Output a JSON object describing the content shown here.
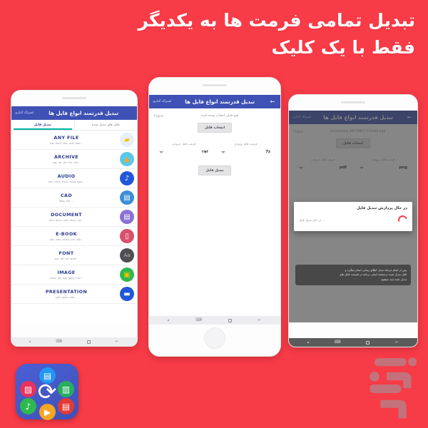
{
  "headline": {
    "line1": "تبدیل تمامی فرمت ها به یکدیگر",
    "line2": "فقط با یک کلیک"
  },
  "colors": {
    "background_red": "#f73b47",
    "appbar_blue": "#3f51b5",
    "tab_accent_teal": "#00b3a4",
    "title_blue": "#2b3a8f",
    "spinner_red": "#f73b47"
  },
  "phone_left": {
    "appbar": {
      "title": "تبدیل قدرتمند انواع فایل ها",
      "subtitle": "اشتراک گذاری"
    },
    "tabs": [
      {
        "label": "فایل های تبدیل شده",
        "active": false
      },
      {
        "label": "تبدیل فایل",
        "active": true
      }
    ],
    "file_types": [
      {
        "title": "ANY FILE",
        "subtitle": "zip, mp3, doc, pdf, bdp...",
        "icon": "folder-icon",
        "color": "#f2c200",
        "ring": "#e8eff7"
      },
      {
        "title": "ARCHIVE",
        "subtitle": "zip, rar, jar, tar, tar...",
        "icon": "archive-icon",
        "color": "#f5a623",
        "ring": "#5bc8e8"
      },
      {
        "title": "AUDIO",
        "subtitle": "aac, mp3, mp4, m4a, wav...",
        "icon": "music-note-icon",
        "color": "#ffffff",
        "ring": "#2157d8"
      },
      {
        "title": "CAD",
        "subtitle": "dwg, dxf ...",
        "icon": "cad-file-icon",
        "color": "#ffffff",
        "ring": "#3a8ed6"
      },
      {
        "title": "DOCUMENT",
        "subtitle": "doc, docx, pdf, html, txt...",
        "icon": "document-icon",
        "color": "#ffffff",
        "ring": "#8b6fd6"
      },
      {
        "title": "E-BOOK",
        "subtitle": "pdf, azw, azw3, prc, djv...",
        "icon": "ebook-icon",
        "color": "#ffffff",
        "ring": "#d94f6e"
      },
      {
        "title": "FONT",
        "subtitle": "eot, otf, ttf, woff...",
        "icon": "font-aa-icon",
        "color": "#bdbdbd",
        "ring": "#4e4e54"
      },
      {
        "title": "IMAGE",
        "subtitle": "bmp, gif, jpg, jpeg, raw...",
        "icon": "image-icon",
        "color": "#f2c200",
        "ring": "#2fb84f"
      },
      {
        "title": "PRESENTATION",
        "subtitle": "ppt, pptx, odp...",
        "icon": "presentation-icon",
        "color": "#ffffff",
        "ring": "#2157d8"
      }
    ],
    "navbar": {
      "back": "◁",
      "home": "□",
      "recents": "•"
    }
  },
  "phone_center": {
    "appbar": {
      "title": "تبدیل قدرتمند انواع فایل ها",
      "subtitle": "اشتراک گذاری",
      "back_icon": "arrow-left-icon"
    },
    "form": {
      "tag": "Fagels",
      "no_file_text": "هیچ فایلی انتخاب نشده است",
      "select_file_button": "انتخاب فایل",
      "input_format_label": "فرمت فایل ورودی",
      "input_format_value": "7z",
      "output_format_label": "فرمت فایل خروجی",
      "output_format_value": "rar",
      "convert_button": "تبدیل فایل"
    }
  },
  "phone_right": {
    "appbar": {
      "title": "تبدیل قدرتمند انواع فایل ها",
      "subtitle": "اشتراک گذاری",
      "back_icon": "arrow-left-icon"
    },
    "form": {
      "tag": "Fagels",
      "file_name": "Screenshot_20170817-121446.png",
      "select_file_button": "انتخاب فایل",
      "input_format_label": "فرمت فایل ورودی",
      "input_format_value": "png",
      "output_format_label": "فرمت فایل خروجی",
      "output_format_value": "pdf"
    },
    "dialog": {
      "title": "در حال پردازش تبدیل فایل",
      "status": "... در حال تبدیل فایل",
      "spinner": "loading-spinner-icon"
    },
    "toast": {
      "line1": "پس از اتمام مرحله تبدیل اطلاع رسانی انجام میگیرد و",
      "line2": "فایل تبدیل شده درصفحه اصلی برنامه در قسمت فایل های",
      "line3": "تبدیل شده ثبت میشود"
    }
  },
  "app_icon": {
    "name": "file-converter-app-icon",
    "center_glyph": "refresh-arrows-icon",
    "minis": [
      {
        "name": "image-mini-icon",
        "glyph": "▨",
        "color": "#e8315c"
      },
      {
        "name": "document-mini-icon",
        "glyph": "▤",
        "color": "#2196f3"
      },
      {
        "name": "book-mini-icon",
        "glyph": "▥",
        "color": "#27ae60"
      },
      {
        "name": "pdf-mini-icon",
        "glyph": "▤",
        "color": "#e53935"
      },
      {
        "name": "video-mini-icon",
        "glyph": "▶",
        "color": "#f5a623"
      },
      {
        "name": "music-mini-icon",
        "glyph": "♪",
        "color": "#2fb84f"
      }
    ]
  },
  "watermark": {
    "label": "بازار"
  }
}
